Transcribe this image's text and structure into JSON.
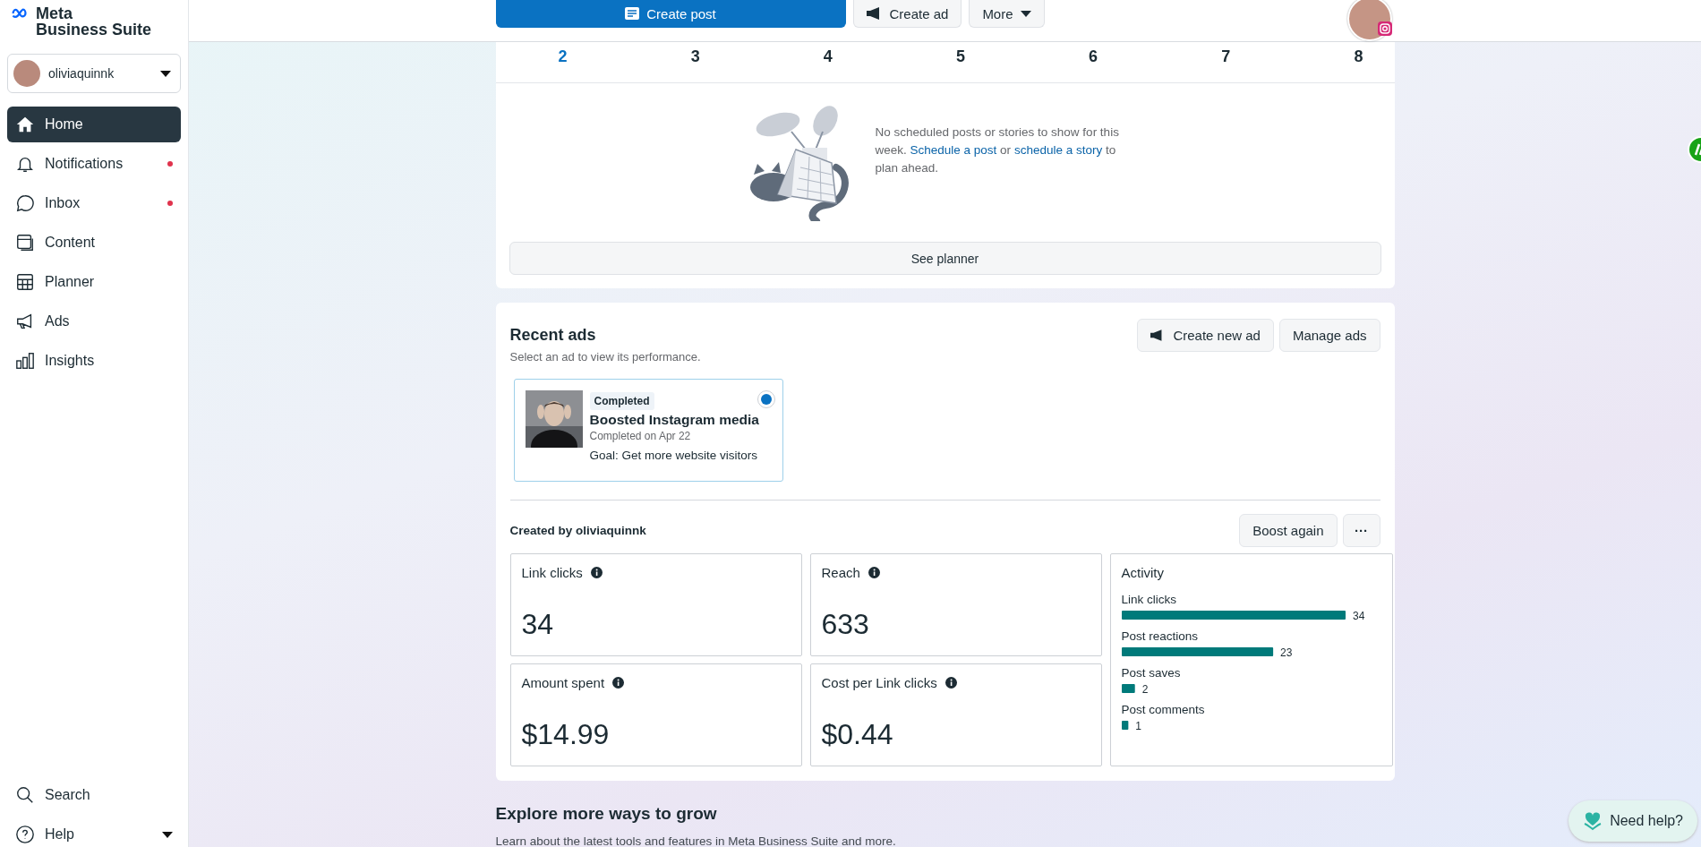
{
  "brand": {
    "line1": "Meta",
    "line2": "Business Suite"
  },
  "account": {
    "name": "oliviaquinnk"
  },
  "nav": [
    {
      "label": "Home",
      "selected": true,
      "badge": false
    },
    {
      "label": "Notifications",
      "selected": false,
      "badge": true
    },
    {
      "label": "Inbox",
      "selected": false,
      "badge": true
    },
    {
      "label": "Content",
      "selected": false,
      "badge": false
    },
    {
      "label": "Planner",
      "selected": false,
      "badge": false
    },
    {
      "label": "Ads",
      "selected": false,
      "badge": false
    },
    {
      "label": "Insights",
      "selected": false,
      "badge": false
    }
  ],
  "nav_bottom": [
    {
      "label": "Search"
    },
    {
      "label": "Help"
    }
  ],
  "toolbar": [
    {
      "label": "Create post",
      "kind": "primary"
    },
    {
      "label": "Create ad",
      "kind": "ad"
    },
    {
      "label": "More",
      "kind": "menu"
    }
  ],
  "week": [
    {
      "date": "2",
      "selected": true
    },
    {
      "date": "3",
      "selected": false
    },
    {
      "date": "4",
      "selected": false
    },
    {
      "date": "5",
      "selected": false
    },
    {
      "date": "6",
      "selected": false
    },
    {
      "date": "7",
      "selected": false
    },
    {
      "date": "8",
      "selected": false
    }
  ],
  "empty_state": {
    "text_before": "No scheduled posts or stories to show for this week.",
    "link_1": "Schedule a post",
    "text_middle": "or",
    "link_2": "schedule a story",
    "text_after": "to plan ahead."
  },
  "see_planner": "See planner",
  "recent_ads": {
    "title": "Recent ads",
    "subtitle": "Select an ad to view its performance.",
    "buttons": [
      {
        "label": "Create new ad",
        "kind": "ad"
      },
      {
        "label": "Manage ads",
        "kind": "plain"
      }
    ],
    "ads": [
      {
        "status": "Completed",
        "title": "Boosted Instagram media",
        "date": "Completed on Apr 22",
        "goal": "Goal: Get more website visitors",
        "selected": true
      }
    ],
    "created_by": "Created by oliviaquinnk",
    "boost": "Boost again",
    "more": "···"
  },
  "stats": [
    {
      "label": "Link clicks",
      "value": "34"
    },
    {
      "label": "Reach",
      "value": "633"
    },
    {
      "label": "Amount spent",
      "value": "$14.99"
    },
    {
      "label": "Cost per Link clicks",
      "value": "$0.44"
    }
  ],
  "activity": {
    "title": "Activity",
    "chart_data": {
      "type": "bar",
      "orientation": "horizontal",
      "categories": [
        "Link clicks",
        "Post reactions",
        "Post saves",
        "Post comments"
      ],
      "values": [
        34,
        23,
        2,
        1
      ],
      "data_labels": true
    }
  },
  "explore": {
    "title": "Explore more ways to grow",
    "subtitle": "Learn about the latest tools and features in Meta Business Suite and more."
  },
  "help_button": "Need help?"
}
